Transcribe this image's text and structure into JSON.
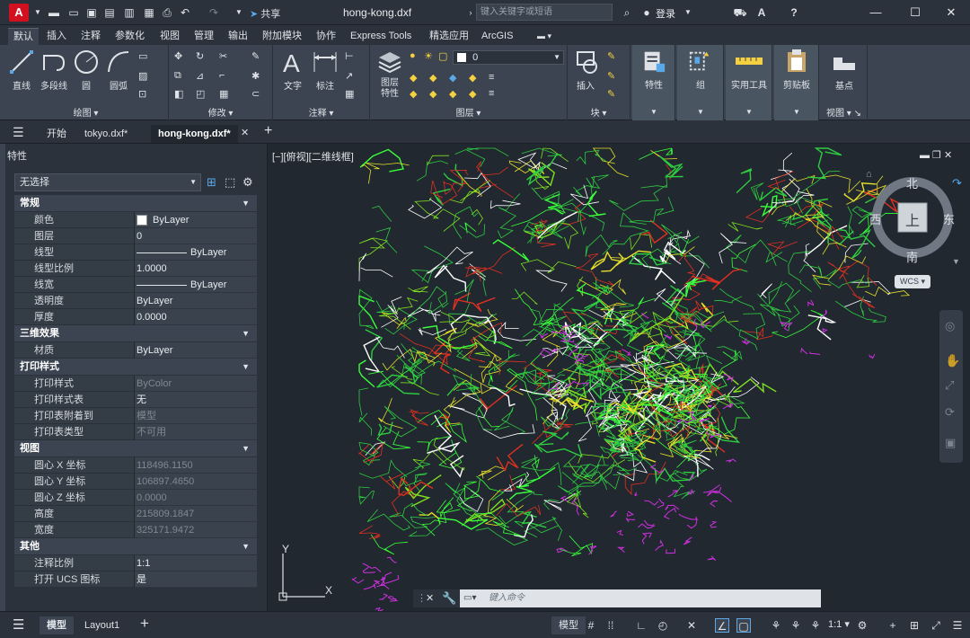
{
  "title_bar": {
    "app_logo": "A",
    "share_label": "共享",
    "document_title": "hong-kong.dxf",
    "search_placeholder": "键入关键字或短语",
    "login_label": "登录"
  },
  "ribbon_tabs": [
    "默认",
    "插入",
    "注释",
    "参数化",
    "视图",
    "管理",
    "输出",
    "附加模块",
    "协作",
    "Express Tools",
    "精选应用",
    "ArcGIS"
  ],
  "ribbon_active_tab": "默认",
  "ribbon": {
    "draw_panel": {
      "label": "绘图",
      "buttons": [
        "直线",
        "多段线",
        "圆",
        "圆弧"
      ]
    },
    "modify_panel": {
      "label": "修改"
    },
    "annotation_panel": {
      "label": "注释",
      "buttons": [
        "文字",
        "标注"
      ]
    },
    "layers_panel": {
      "label": "图层",
      "layer_props_label": "图层\n特性",
      "current_layer": "0"
    },
    "block_panel": {
      "label": "块",
      "insert_label": "插入"
    },
    "properties_label": "特性",
    "groups_label": "组",
    "utilities_label": "实用工具",
    "clipboard_label": "剪贴板",
    "view_panel": {
      "label": "视图",
      "base_label": "基点"
    }
  },
  "doc_tabs": [
    "开始",
    "tokyo.dxf*",
    "hong-kong.dxf*"
  ],
  "doc_active_tab": "hong-kong.dxf*",
  "properties_palette": {
    "title": "特性",
    "selection": "无选择",
    "sections": [
      {
        "name": "常规",
        "rows": [
          {
            "key": "颜色",
            "value": "ByLayer",
            "swatch": "#ffffff"
          },
          {
            "key": "图层",
            "value": "0"
          },
          {
            "key": "线型",
            "value": "ByLayer",
            "line": true
          },
          {
            "key": "线型比例",
            "value": "1.0000"
          },
          {
            "key": "线宽",
            "value": "ByLayer",
            "line": true
          },
          {
            "key": "透明度",
            "value": "ByLayer"
          },
          {
            "key": "厚度",
            "value": "0.0000"
          }
        ]
      },
      {
        "name": "三维效果",
        "rows": [
          {
            "key": "材质",
            "value": "ByLayer"
          }
        ]
      },
      {
        "name": "打印样式",
        "rows": [
          {
            "key": "打印样式",
            "value": "ByColor",
            "dim": true
          },
          {
            "key": "打印样式表",
            "value": "无"
          },
          {
            "key": "打印表附着到",
            "value": "模型",
            "dim": true
          },
          {
            "key": "打印表类型",
            "value": "不可用",
            "dim": true
          }
        ]
      },
      {
        "name": "视图",
        "rows": [
          {
            "key": "圆心 X 坐标",
            "value": "118496.1150",
            "dim": true
          },
          {
            "key": "圆心 Y 坐标",
            "value": "106897.4650",
            "dim": true
          },
          {
            "key": "圆心 Z 坐标",
            "value": "0.0000",
            "dim": true
          },
          {
            "key": "高度",
            "value": "215809.1847",
            "dim": true
          },
          {
            "key": "宽度",
            "value": "325171.9472",
            "dim": true
          }
        ]
      },
      {
        "name": "其他",
        "rows": [
          {
            "key": "注释比例",
            "value": "1:1"
          },
          {
            "key": "打开 UCS 图标",
            "value": "是"
          }
        ]
      }
    ]
  },
  "viewport": {
    "view_label": "[−][俯视][二维线框]",
    "viewcube": {
      "north": "北",
      "south": "南",
      "east": "东",
      "west": "西",
      "top": "上"
    },
    "wcs_label": "WCS",
    "ucs_x": "X",
    "ucs_y": "Y"
  },
  "command_line": {
    "placeholder": "键入命令"
  },
  "status_bar": {
    "layout_tabs": [
      "模型",
      "Layout1"
    ],
    "active_layout": "模型",
    "model_label": "模型",
    "scale_label": "1:1"
  },
  "colors": {
    "background": "#212830",
    "panel": "#2b323b",
    "ribbon": "#3b4450",
    "accent_red": "#d3101f",
    "map_green": "#2ecc40",
    "map_yellow": "#e6e02a",
    "map_red": "#e03020",
    "map_magenta": "#d030e0",
    "map_white": "#ffffff"
  }
}
